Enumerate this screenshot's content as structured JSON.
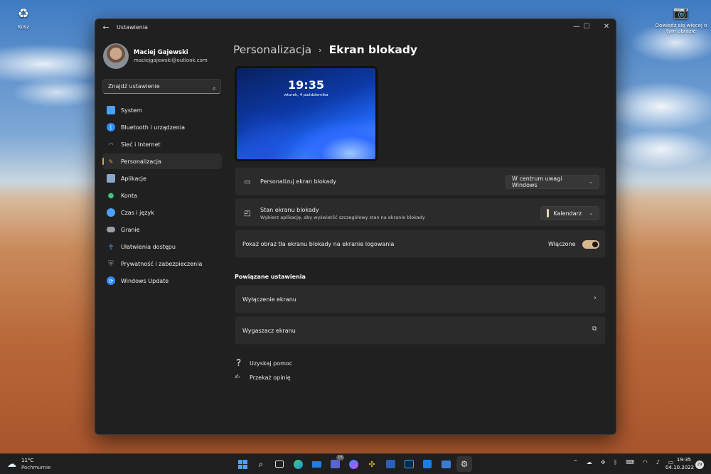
{
  "desktop": {
    "recycle_bin_label": "Kosz",
    "spotlight_label": "Dowiedz się więcej o tym obrazie"
  },
  "window": {
    "title": "Ustawienia",
    "back_glyph": "←",
    "minimize_glyph": "—",
    "maximize_glyph": "☐",
    "close_glyph": "✕"
  },
  "profile": {
    "name": "Maciej Gajewski",
    "email": "maciejgajewski@outlook.com"
  },
  "search": {
    "placeholder": "Znajdź ustawienie"
  },
  "sidebar": {
    "items": [
      {
        "label": "System",
        "icon": "monitor-icon",
        "color": "#4aa3ff"
      },
      {
        "label": "Bluetooth i urządzenia",
        "icon": "bluetooth-icon",
        "color": "#2f8cff"
      },
      {
        "label": "Sieć i Internet",
        "icon": "wifi-icon",
        "color": "#6ab7ff"
      },
      {
        "label": "Personalizacja",
        "icon": "brush-icon",
        "color": "#e0a35a"
      },
      {
        "label": "Aplikacje",
        "icon": "apps-icon",
        "color": "#8aa7c8"
      },
      {
        "label": "Konta",
        "icon": "person-icon",
        "color": "#3fc47a"
      },
      {
        "label": "Czas i język",
        "icon": "globe-clock-icon",
        "color": "#4aa3ff"
      },
      {
        "label": "Granie",
        "icon": "gamepad-icon",
        "color": "#9aa0a6"
      },
      {
        "label": "Ułatwienia dostępu",
        "icon": "accessibility-icon",
        "color": "#4aa3ff"
      },
      {
        "label": "Prywatność i zabezpieczenia",
        "icon": "shield-icon",
        "color": "#8a9099"
      },
      {
        "label": "Windows Update",
        "icon": "update-icon",
        "color": "#2f8cff"
      }
    ]
  },
  "breadcrumb": {
    "parent": "Personalizacja",
    "separator": "›",
    "current": "Ekran blokady"
  },
  "preview": {
    "time": "19:35",
    "date": "wtorek, 4 października"
  },
  "settings": {
    "personalize": {
      "title": "Personalizuj ekran blokady",
      "value": "W centrum uwagi Windows"
    },
    "status": {
      "title": "Stan ekranu blokady",
      "subtitle": "Wybierz aplikację, aby wyświetlić szczegółowy stan na ekranie blokady",
      "value": "Kalendarz"
    },
    "show_bg": {
      "title": "Pokaż obraz tła ekranu blokady na ekranie logowania",
      "state": "Włączone",
      "on": true
    }
  },
  "related": {
    "title": "Powiązane ustawienia",
    "items": [
      {
        "label": "Wyłączenie ekranu",
        "glyph": "›"
      },
      {
        "label": "Wygaszacz ekranu",
        "glyph": "⧉"
      }
    ]
  },
  "help": {
    "get_help": "Uzyskaj pomoc",
    "feedback": "Przekaż opinię"
  },
  "taskbar": {
    "weather_temp": "11°C",
    "weather_desc": "Pochmurnie",
    "teams_badge": "15",
    "time": "19:35",
    "date": "04.10.2022",
    "notifications": "29"
  }
}
